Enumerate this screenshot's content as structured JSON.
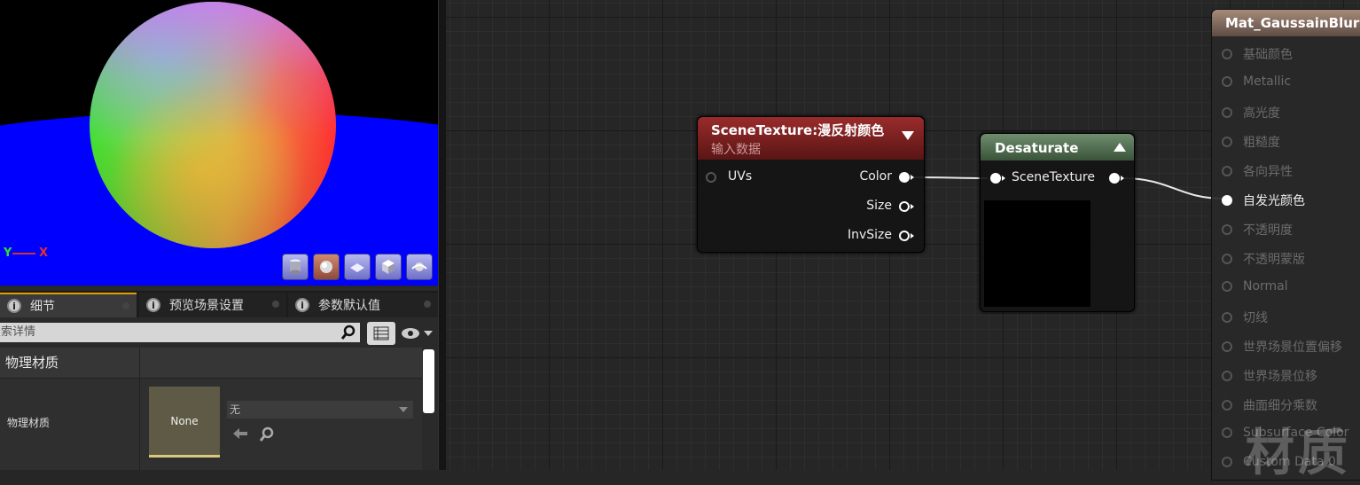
{
  "viewport": {
    "axis_y": "Y",
    "axis_x": "X",
    "buttons": [
      {
        "name": "cylinder-preview-icon"
      },
      {
        "name": "sphere-preview-icon"
      },
      {
        "name": "plane-preview-icon"
      },
      {
        "name": "cube-preview-icon"
      },
      {
        "name": "custom-mesh-preview-icon"
      }
    ]
  },
  "details": {
    "tabs": [
      {
        "label": "细节"
      },
      {
        "label": "预览场景设置"
      },
      {
        "label": "参数默认值"
      }
    ],
    "search_placeholder": "搜索详情",
    "category": "物理材质",
    "property_label": "物理材质",
    "thumbnail_text": "None",
    "combo_value": "无"
  },
  "graph": {
    "scene_texture": {
      "title": "SceneTexture:漫反射颜色",
      "subtitle": "输入数据",
      "input": "UVs",
      "outputs": [
        "Color",
        "Size",
        "InvSize"
      ]
    },
    "desaturate": {
      "title": "Desaturate",
      "input": "SceneTexture"
    },
    "result": {
      "title": "Mat_GaussainBlur",
      "inputs": [
        {
          "label": "基础颜色",
          "connected": false
        },
        {
          "label": "Metallic",
          "connected": false
        },
        {
          "label": "高光度",
          "connected": false
        },
        {
          "label": "粗糙度",
          "connected": false
        },
        {
          "label": "各向异性",
          "connected": false
        },
        {
          "label": "自发光颜色",
          "connected": true
        },
        {
          "label": "不透明度",
          "connected": false
        },
        {
          "label": "不透明蒙版",
          "connected": false
        },
        {
          "label": "Normal",
          "connected": false
        },
        {
          "label": "切线",
          "connected": false
        },
        {
          "label": "世界场景位置偏移",
          "connected": false
        },
        {
          "label": "世界场景位移",
          "connected": false
        },
        {
          "label": "曲面细分乘数",
          "connected": false
        },
        {
          "label": "Subsurface Color",
          "connected": false
        },
        {
          "label": "Custom Data 0",
          "connected": false
        }
      ]
    },
    "watermark": "材质"
  },
  "colors": {
    "scene_texture_header": "#8a1f1f",
    "desaturate_header": "#4f6b4f",
    "result_header": "#8d7565",
    "floor": "#0000ff",
    "tab_active_accent": "#e0a000"
  }
}
